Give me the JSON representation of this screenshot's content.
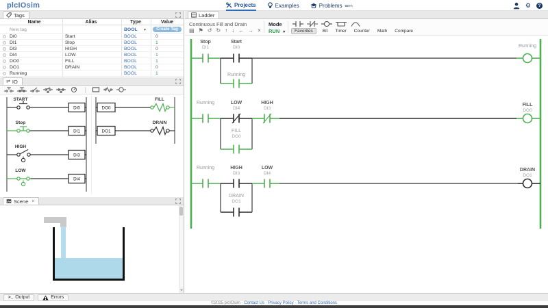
{
  "header": {
    "logo": "plcIOsim",
    "nav": [
      {
        "label": "Projects",
        "icon": "tools-icon",
        "active": true
      },
      {
        "label": "Examples",
        "icon": "lightbulb-icon",
        "active": false
      },
      {
        "label": "Problems",
        "icon": "graduation-cap-icon",
        "badge": "BETA",
        "active": false
      }
    ]
  },
  "glyphs": {
    "swap": "⇄",
    "caret": "▾",
    "close": "×",
    "terminal": ">_",
    "settings": "⚙",
    "help": "?"
  },
  "tags_panel": {
    "tab_label": "Tags",
    "headers": {
      "name": "Name",
      "alias": "Alias",
      "type": "Type",
      "value": "Value"
    },
    "new_row": {
      "placeholder": "New tag",
      "type": "BOOL",
      "create_button": "Create Tag"
    },
    "rows": [
      {
        "name": "DI0",
        "alias": "Start",
        "type": "BOOL",
        "value": "0"
      },
      {
        "name": "DI1",
        "alias": "Stop",
        "type": "BOOL",
        "value": "1"
      },
      {
        "name": "DI3",
        "alias": "HIGH",
        "type": "BOOL",
        "value": "0"
      },
      {
        "name": "DI4",
        "alias": "LOW",
        "type": "BOOL",
        "value": "1"
      },
      {
        "name": "DO0",
        "alias": "FILL",
        "type": "BOOL",
        "value": "1"
      },
      {
        "name": "DO1",
        "alias": "DRAIN",
        "type": "BOOL",
        "value": "0"
      },
      {
        "name": "Running",
        "alias": "",
        "type": "BOOL",
        "value": "1"
      }
    ]
  },
  "io_panel": {
    "tab_label": "IO",
    "inputs": [
      {
        "label": "START",
        "address": "DI0",
        "kind": "momentary-pushbutton-no",
        "state": 0
      },
      {
        "label": "Stop",
        "address": "DI1",
        "kind": "pushbutton-nc",
        "state": 1
      },
      {
        "label": "HIGH",
        "address": "DI3",
        "kind": "float-switch",
        "state": 0
      },
      {
        "label": "LOW",
        "address": "DI4",
        "kind": "float-switch",
        "state": 1
      }
    ],
    "outputs": [
      {
        "label": "FILL",
        "address": "DO0",
        "kind": "indicator-lamp",
        "state": 1
      },
      {
        "label": "DRAIN",
        "address": "DO1",
        "kind": "indicator-lamp",
        "state": 0
      }
    ]
  },
  "scene_panel": {
    "tab_label": "Scene"
  },
  "ladder_panel": {
    "tab_label": "Ladder",
    "project_name": "Continuous Fill and Drain",
    "mode_label": "Mode",
    "mode_value": "RUN",
    "toolbar_icons": [
      {
        "name": "select-icon",
        "glyph": "▤"
      },
      {
        "name": "flag-icon",
        "glyph": "⚑"
      },
      {
        "name": "undo-icon",
        "glyph": "↺"
      },
      {
        "name": "redo-icon",
        "glyph": "↻"
      },
      {
        "name": "move-up-icon",
        "glyph": "↑"
      },
      {
        "name": "move-down-icon",
        "glyph": "↓"
      },
      {
        "name": "move-left-icon",
        "glyph": "←"
      },
      {
        "name": "move-right-icon",
        "glyph": "→"
      },
      {
        "name": "delete-icon",
        "glyph": "×"
      }
    ],
    "categories": [
      "Favorites",
      "Bit",
      "Timer",
      "Counter",
      "Math",
      "Compare"
    ],
    "active_category": "Favorites",
    "rungs": {
      "rung1": {
        "contact1": "Stop",
        "contact1_addr": "DI1",
        "contact2": "Start",
        "contact2_addr": "DI0",
        "branch": "Running",
        "branch_addr": "",
        "coil": "Running",
        "coil_addr": ""
      },
      "rung2": {
        "contact1": "Running",
        "contact1_addr": "",
        "contact2": "LOW",
        "contact2_addr": "DI4",
        "branch": "FILL",
        "branch_addr": "DO0",
        "contact3": "HIGH",
        "contact3_addr": "DI3",
        "coil": "FILL",
        "coil_addr": "DO0"
      },
      "rung3": {
        "contact1": "Running",
        "contact1_addr": "",
        "contact2": "HIGH",
        "contact2_addr": "DI3",
        "branch": "DRAIN",
        "branch_addr": "DO1",
        "contact3": "LOW",
        "contact3_addr": "DI4",
        "coil": "DRAIN",
        "coil_addr": "DO1"
      }
    }
  },
  "bottom_bar": {
    "output_tab": "Output",
    "errors_tab": "Errors"
  },
  "footer": {
    "copyright": "©2025 plcIOsim",
    "sep": "·",
    "links": [
      "Contact Us",
      "Privacy Policy",
      "Terms and Conditions"
    ]
  },
  "colors": {
    "energized": "#4caf50",
    "wire_off": "#2b2b2b",
    "accent_blue": "#3b6fb5",
    "create_button": "#8cb9dc",
    "run_green": "#2e9e4f",
    "water": "#aed9ea"
  }
}
